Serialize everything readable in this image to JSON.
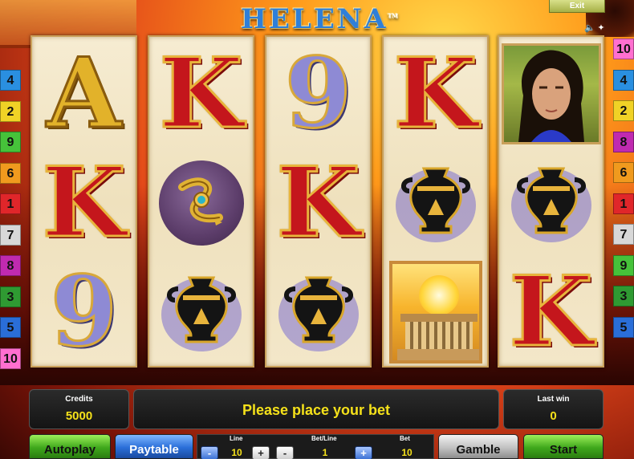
{
  "header": {
    "logo_text": "HELENA",
    "trademark": "TM",
    "exit_label": "Exit"
  },
  "left_lines": [
    "4",
    "2",
    "9",
    "6",
    "1",
    "7",
    "8",
    "3",
    "5",
    "10"
  ],
  "right_lines": [
    "10",
    "4",
    "2",
    "8",
    "6",
    "1",
    "7",
    "9",
    "3",
    "5"
  ],
  "line_colors": {
    "1": "#e0262a",
    "2": "#f0d226",
    "3": "#2f9a32",
    "4": "#2a8fe0",
    "5": "#2a6ed8",
    "6": "#f09a1e",
    "7": "#d8d8d8",
    "8": "#c02ab0",
    "9": "#46c23a",
    "10": "#ff6fd0"
  },
  "reels": [
    [
      "A",
      "K",
      "9"
    ],
    [
      "K",
      "snake-bracelet",
      "vase"
    ],
    [
      "9",
      "K",
      "vase"
    ],
    [
      "K",
      "vase",
      "temple"
    ],
    [
      "helena-portrait",
      "vase",
      "K"
    ]
  ],
  "info": {
    "credits_label": "Credits",
    "credits_value": "5000",
    "message": "Please place your bet",
    "last_win_label": "Last win",
    "last_win_value": "0"
  },
  "controls": {
    "autoplay": "Autoplay",
    "paytable": "Paytable",
    "line_label": "Line",
    "line_value": "10",
    "betline_label": "Bet/Line",
    "betline_value": "1",
    "bet_label": "Bet",
    "bet_value": "10",
    "minus": "-",
    "plus": "+",
    "gamble": "Gamble",
    "start": "Start"
  }
}
